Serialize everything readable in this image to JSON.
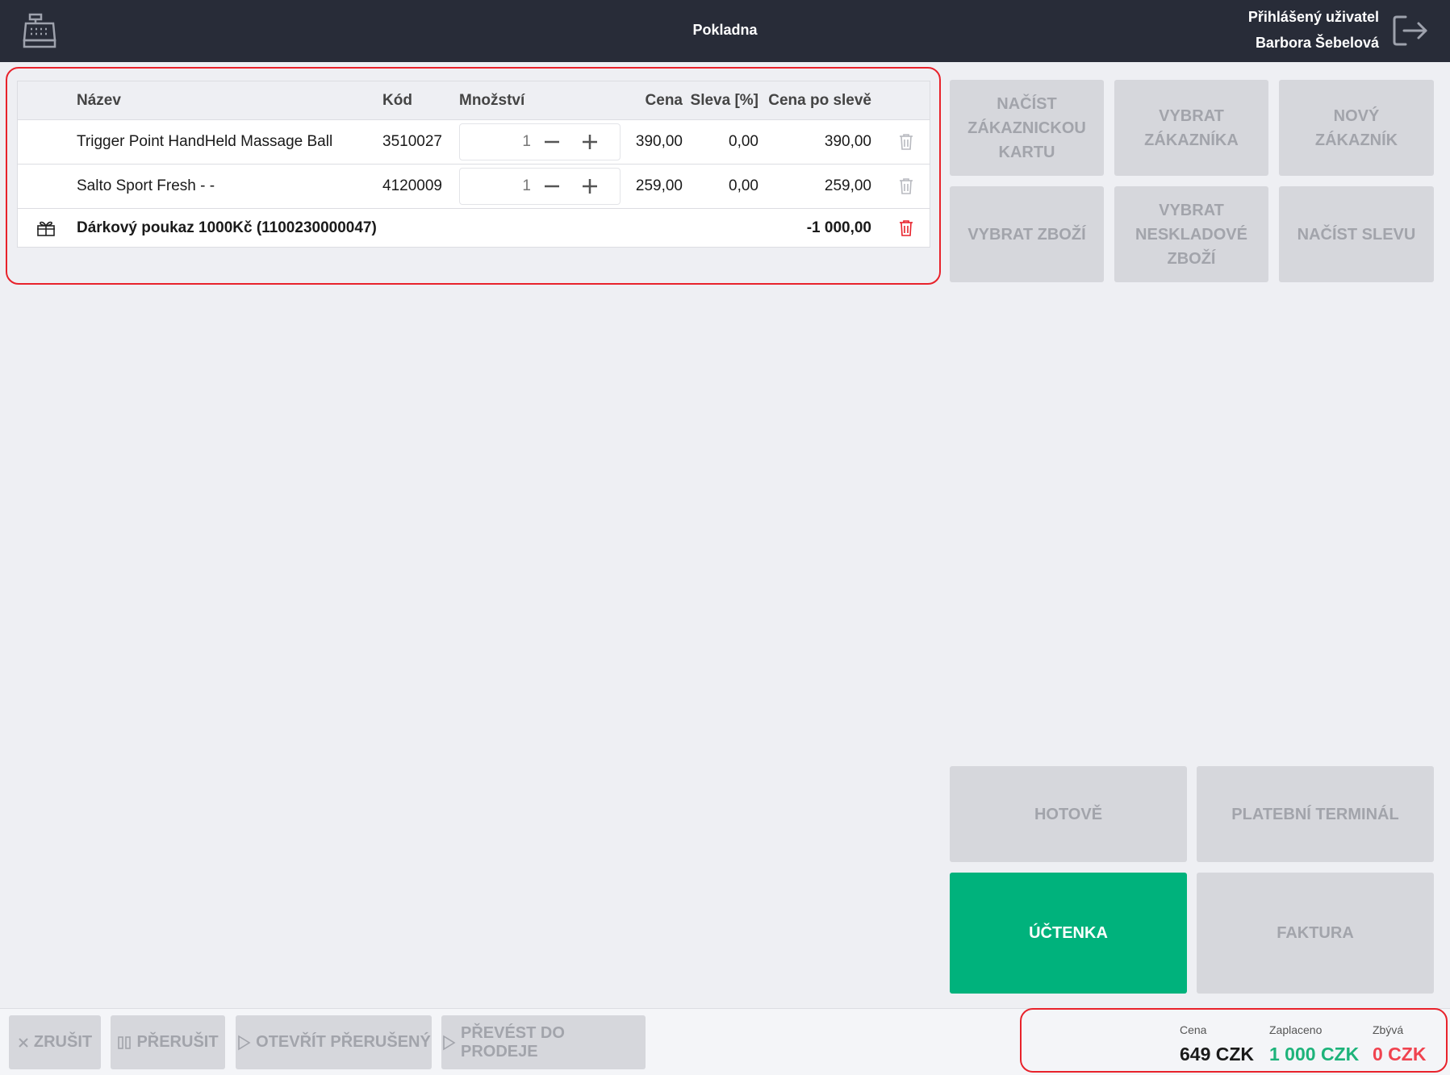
{
  "header": {
    "title": "Pokladna",
    "user_caption": "Přihlášený uživatel",
    "user_name": "Barbora Šebelová",
    "register_icon": "cash-register-icon",
    "logout_icon": "logout-icon"
  },
  "table": {
    "columns": [
      "Název",
      "Kód",
      "Množství",
      "Cena",
      "Sleva [%]",
      "Cena po slevě"
    ],
    "rows": [
      {
        "name": "Trigger Point HandHeld Massage Ball",
        "code": "3510027",
        "qty": "1",
        "price": "390,00",
        "discount": "0,00",
        "price_after": "390,00"
      },
      {
        "name": "Salto Sport Fresh - -",
        "code": "4120009",
        "qty": "1",
        "price": "259,00",
        "discount": "0,00",
        "price_after": "259,00"
      }
    ],
    "voucher": {
      "icon": "gift-icon",
      "name": "Dárkový poukaz 1000Kč (1100230000047)",
      "amount": "-1 000,00"
    }
  },
  "actions": {
    "load_card": "Načíst zákaznickou kartu",
    "choose_customer": "Vybrat zákazníka",
    "new_customer": "Nový zákazník",
    "choose_goods": "Vybrat zboží",
    "choose_nonstock": "Vybrat neskladové zboží",
    "load_discount": "Načíst slevu"
  },
  "payment": {
    "cash": "HOTOVĚ",
    "terminal": "PLATEBNÍ TERMINÁL",
    "receipt": "ÚČTENKA",
    "invoice": "FAKTURA"
  },
  "footer": {
    "cancel": "ZRUŠIT",
    "pause": "PŘERUŠIT",
    "open_paused": "OTEVŘÍT PŘERUŠENÝ",
    "convert": "PŘEVÉST DO PRODEJE"
  },
  "totals": {
    "price_label": "Cena",
    "price_value": "649 CZK",
    "paid_label": "Zaplaceno",
    "paid_value": "1 000 CZK",
    "remaining_label": "Zbývá",
    "remaining_value": "0 CZK"
  },
  "colors": {
    "header_bg": "#282c38",
    "accent_green": "#00b27c",
    "alert_red": "#e8222b",
    "paid_green": "#1db37a",
    "remaining_red": "#f0434f"
  }
}
